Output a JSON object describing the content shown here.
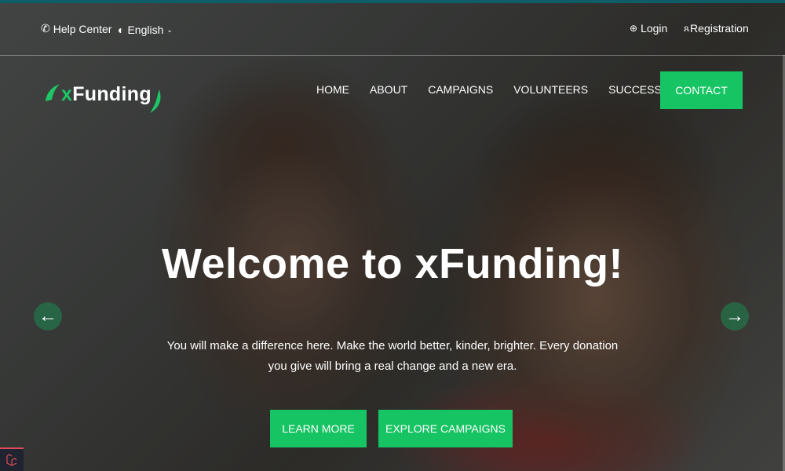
{
  "header": {
    "help_center": "Help Center",
    "language": "English",
    "login": "Login",
    "registration": "Registration"
  },
  "logo": {
    "prefix": "x",
    "name": "Funding"
  },
  "nav": {
    "items": [
      "HOME",
      "ABOUT",
      "CAMPAIGNS",
      "VOLUNTEERS",
      "SUCCESS STORY"
    ],
    "contact": "CONTACT"
  },
  "hero": {
    "title": "Welcome to xFunding!",
    "subtitle": "You will make a difference here. Make the world better, kinder, brighter. Every donation you give will bring a real change and a new era.",
    "learn_more": "LEARN MORE",
    "explore": "EXPLORE CAMPAIGNS"
  },
  "colors": {
    "accent": "#17c463",
    "topbar": "#0e5d69"
  }
}
